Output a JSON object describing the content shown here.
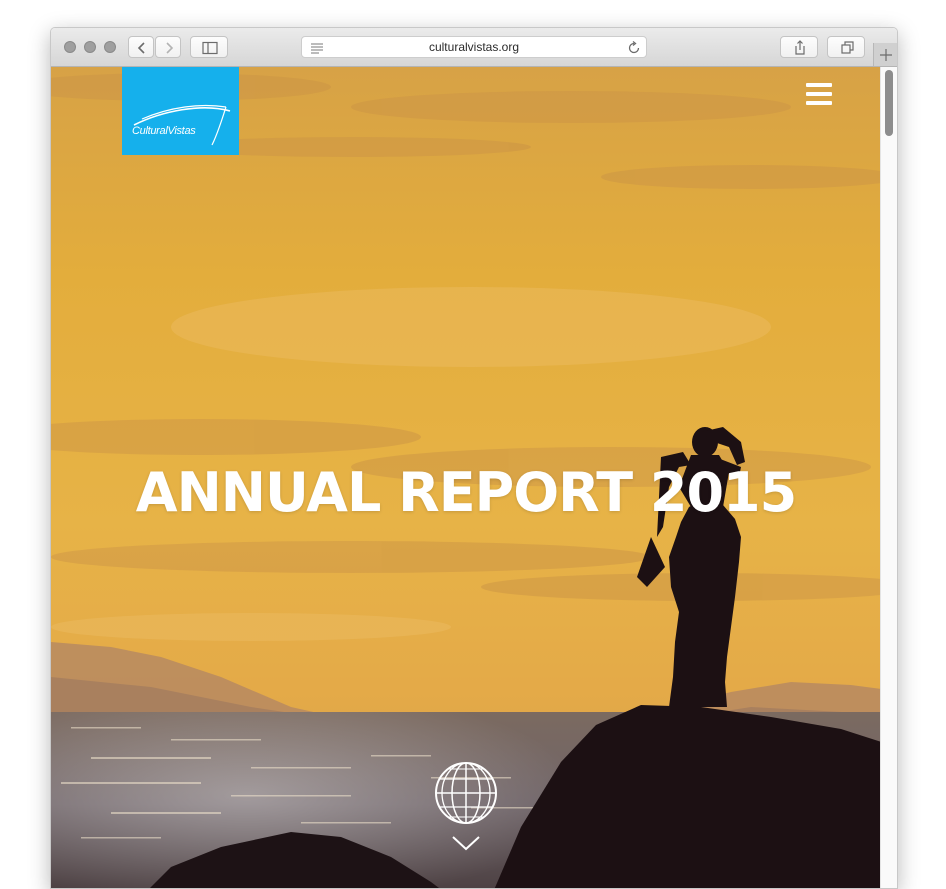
{
  "browser": {
    "url": "culturalvistas.org",
    "icons": {
      "back": "chevron-left-icon",
      "forward": "chevron-right-icon",
      "sidebar": "sidebar-icon",
      "reader": "reader-lines-icon",
      "reload": "reload-icon",
      "share": "share-icon",
      "tabs": "tabs-overview-icon",
      "new_tab": "plus-icon"
    }
  },
  "site": {
    "logo_text": "CulturalVistas",
    "hero_title": "ANNUAL REPORT 2015",
    "icons": {
      "menu": "hamburger-menu-icon",
      "globe": "globe-icon",
      "scroll_down": "chevron-down-icon"
    }
  },
  "colors": {
    "logo_background": "#15b0ec",
    "hero_text": "#ffffff",
    "sky": "#e0a93a"
  }
}
